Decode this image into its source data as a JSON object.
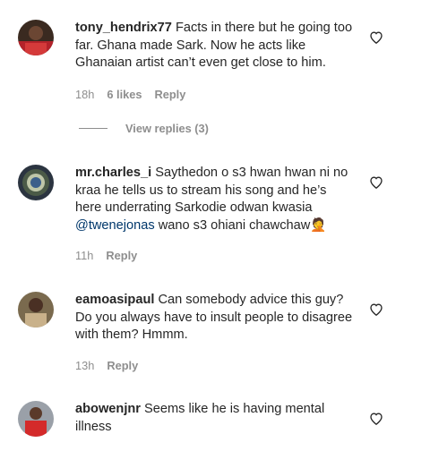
{
  "comments": [
    {
      "username": "tony_hendrix77",
      "text": "Facts in there but he going too far. Ghana made Sark. Now he acts like Ghanaian artist can’t even get close to him.",
      "time": "18h",
      "likes": "6 likes",
      "reply": "Reply"
    },
    {
      "username": "mr.charles_i",
      "text_before": "Saythedon o s3 hwan hwan ni no kraa he tells us to stream his song and he’s here underrating Sarkodie odwan kwasia ",
      "mention": "@twenejonas",
      "text_after": " wano s3 ohiani chawchaw🤦",
      "time": "11h",
      "reply": "Reply"
    },
    {
      "username": "eamoasipaul",
      "text": "Can somebody advice this guy? Do you always have to insult people to disagree with them? Hmmm.",
      "time": "13h",
      "reply": "Reply"
    },
    {
      "username": "abowenjnr",
      "text": "Seems like he is having mental illness"
    }
  ],
  "view_replies": "View replies (3)",
  "icons": {
    "like": "heart-outline-icon"
  },
  "colors": {
    "text": "#262626",
    "secondary": "#8e8e8e",
    "mention": "#00376b"
  }
}
